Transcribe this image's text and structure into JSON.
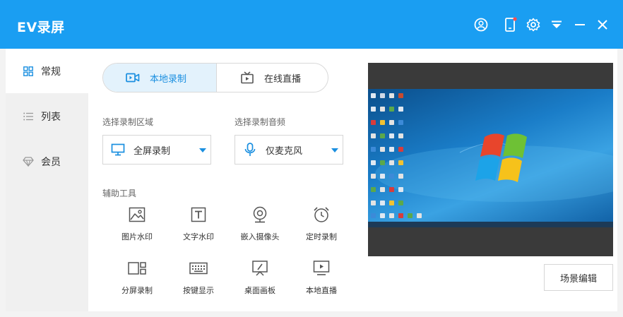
{
  "app": {
    "title": "EV录屏"
  },
  "titlebar": {
    "icons": [
      "user-icon",
      "phone-icon",
      "settings-icon",
      "dropdown-icon",
      "minimize-icon",
      "close-icon"
    ]
  },
  "sidebar": {
    "items": [
      {
        "label": "常规",
        "icon": "grid-icon",
        "active": true
      },
      {
        "label": "列表",
        "icon": "list-icon",
        "active": false
      },
      {
        "label": "会员",
        "icon": "diamond-icon",
        "active": false
      }
    ]
  },
  "mode": {
    "local_label": "本地录制",
    "live_label": "在线直播",
    "selected": "本地录制"
  },
  "region": {
    "label": "选择录制区域",
    "value": "全屏录制"
  },
  "audio": {
    "label": "选择录制音频",
    "value": "仅麦克风"
  },
  "tools": {
    "label": "辅助工具",
    "items": [
      {
        "label": "图片水印",
        "icon": "image-icon"
      },
      {
        "label": "文字水印",
        "icon": "text-icon"
      },
      {
        "label": "嵌入摄像头",
        "icon": "webcam-icon"
      },
      {
        "label": "定时录制",
        "icon": "alarm-icon"
      },
      {
        "label": "分屏录制",
        "icon": "split-screen-icon"
      },
      {
        "label": "按键显示",
        "icon": "keyboard-icon"
      },
      {
        "label": "桌面画板",
        "icon": "whiteboard-icon"
      },
      {
        "label": "本地直播",
        "icon": "monitor-play-icon"
      }
    ]
  },
  "scene_button": {
    "label": "场景编辑"
  },
  "colors": {
    "accent": "#1a9ef2",
    "active_tab_bg": "#e3f2fc",
    "accent_text": "#1a8fe0"
  }
}
